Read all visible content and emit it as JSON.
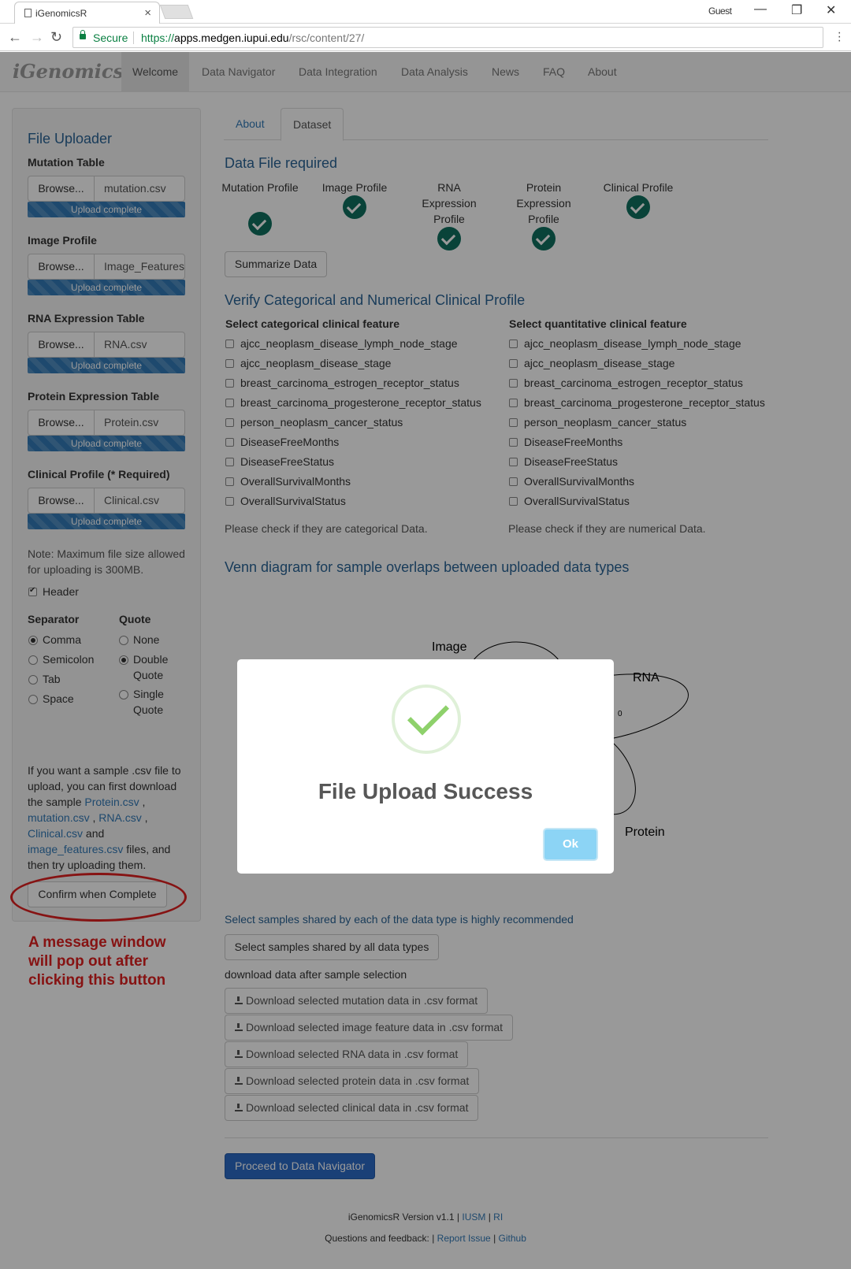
{
  "browser": {
    "tab_title": "iGenomicsR",
    "user": "Guest",
    "secure_label": "Secure",
    "url_scheme": "https://",
    "url_host": "apps.medgen.iupui.edu",
    "url_path": "/rsc/content/27/"
  },
  "navbar": {
    "brand_a": "iGenomics",
    "brand_b": "R",
    "items": [
      "Welcome",
      "Data Navigator",
      "Data Integration",
      "Data Analysis",
      "News",
      "FAQ",
      "About"
    ]
  },
  "sidebar": {
    "title": "File Uploader",
    "uploads": [
      {
        "label": "Mutation Table",
        "browse": "Browse...",
        "file": "mutation.csv",
        "status": "Upload complete"
      },
      {
        "label": "Image Profile",
        "browse": "Browse...",
        "file": "Image_Features.csv",
        "status": "Upload complete"
      },
      {
        "label": "RNA Expression Table",
        "browse": "Browse...",
        "file": "RNA.csv",
        "status": "Upload complete"
      },
      {
        "label": "Protein Expression Table",
        "browse": "Browse...",
        "file": "Protein.csv",
        "status": "Upload complete"
      },
      {
        "label": "Clinical Profile (* Required)",
        "browse": "Browse...",
        "file": "Clinical.csv",
        "status": "Upload complete"
      }
    ],
    "note": "Note: Maximum file size allowed for uploading is 300MB.",
    "header_label": "Header",
    "separator_label": "Separator",
    "separators": [
      "Comma",
      "Semicolon",
      "Tab",
      "Space"
    ],
    "quote_label": "Quote",
    "quotes": [
      "None",
      "Double Quote",
      "Single Quote"
    ],
    "sample_text_1": "If you want a sample .csv file to upload, you can first download the sample",
    "link_protein": "Protein.csv",
    "link_mutation": "mutation.csv",
    "link_rna": "RNA.csv",
    "link_clinical": "Clinical.csv",
    "link_image": "image_features.csv",
    "sample_and": "and",
    "sample_text_2": "files, and then try uploading them.",
    "confirm_button": "Confirm when Complete",
    "annotation": "A message window will pop out after clicking this button"
  },
  "tabs": [
    "About",
    "Dataset"
  ],
  "dataset": {
    "required_title": "Data File required",
    "profiles": [
      "Mutation Profile",
      "Image Profile",
      "RNA Expression Profile",
      "Protein Expression Profile",
      "Clinical Profile"
    ],
    "summarize_button": "Summarize Data",
    "verify_title": "Verify Categorical and Numerical Clinical Profile",
    "cat_header": "Select categorical clinical feature",
    "num_header": "Select quantitative clinical feature",
    "features": [
      "ajcc_neoplasm_disease_lymph_node_stage",
      "ajcc_neoplasm_disease_stage",
      "breast_carcinoma_estrogen_receptor_status",
      "breast_carcinoma_progesterone_receptor_status",
      "person_neoplasm_cancer_status",
      "DiseaseFreeMonths",
      "DiseaseFreeStatus",
      "OverallSurvivalMonths",
      "OverallSurvivalStatus"
    ],
    "cat_note": "Please check if they are categorical Data.",
    "num_note": "Please check if they are numerical Data.",
    "venn_title": "Venn diagram for sample overlaps between uploaded data types",
    "venn_labels": [
      "Image",
      "RNA",
      "Protein"
    ],
    "venn_value": "0",
    "shared_note": "Select samples shared by each of the data type is highly recommended",
    "shared_button": "Select samples shared by all data types",
    "download_note": "download data after sample selection",
    "downloads": [
      "Download selected mutation data in .csv format",
      "Download selected image feature data in .csv format",
      "Download selected RNA data in .csv format",
      "Download selected protein data in .csv format",
      "Download selected clinical data in .csv format"
    ],
    "proceed_button": "Proceed to Data Navigator"
  },
  "footer": {
    "version": "iGenomicsR Version v1.1 |",
    "iusm": "IUSM",
    "bar": "|",
    "ri": "RI",
    "questions": "Questions and feedback: |",
    "report": "Report Issue",
    "bar2": "|",
    "github": "Github"
  },
  "modal": {
    "title": "File Upload Success",
    "ok": "Ok"
  },
  "colors": {
    "accent": "#337ab7",
    "check_green": "#0f7060",
    "annotation_red": "#e02020",
    "ok_button": "#8cd4f5"
  }
}
